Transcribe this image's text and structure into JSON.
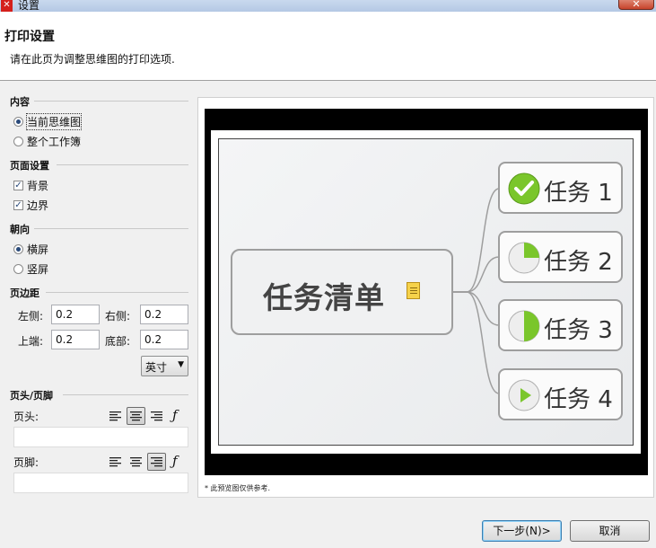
{
  "window": {
    "title": "设置",
    "app_icon_glyph": "✕",
    "close_glyph": "✕"
  },
  "header": {
    "title": "打印设置",
    "subtitle": "请在此页为调整思维图的打印选项."
  },
  "content": {
    "label": "内容",
    "options": [
      {
        "label": "当前思维图",
        "selected": true
      },
      {
        "label": "整个工作簿",
        "selected": false
      }
    ]
  },
  "page_setup": {
    "label": "页面设置",
    "options": [
      {
        "label": "背景",
        "checked": true
      },
      {
        "label": "边界",
        "checked": true
      }
    ]
  },
  "orientation": {
    "label": "朝向",
    "options": [
      {
        "label": "横屏",
        "selected": true
      },
      {
        "label": "竖屏",
        "selected": false
      }
    ]
  },
  "margins": {
    "label": "页边距",
    "left_label": "左侧:",
    "left_value": "0.2",
    "right_label": "右侧:",
    "right_value": "0.2",
    "top_label": "上端:",
    "top_value": "0.2",
    "bottom_label": "底部:",
    "bottom_value": "0.2",
    "unit": "英寸",
    "unit_arrow": "▼"
  },
  "header_footer": {
    "label": "页头/页脚",
    "header_label": "页头:",
    "footer_label": "页脚:",
    "header_selected_align": "center",
    "footer_selected_align": "right",
    "fx_glyph": "ƒ",
    "header_value": "",
    "footer_value": ""
  },
  "preview": {
    "central_topic": "任务清单",
    "tasks": [
      {
        "label": "任务 1",
        "icon": "check-icon",
        "progress": 1.0
      },
      {
        "label": "任务 2",
        "icon": "pie-quarter-icon",
        "progress": 0.25
      },
      {
        "label": "任务 3",
        "icon": "pie-half-icon",
        "progress": 0.5
      },
      {
        "label": "任务 4",
        "icon": "play-icon",
        "progress": 0
      }
    ],
    "note": "* 此预览图仅供参考."
  },
  "buttons": {
    "next": "下一步(N)>",
    "cancel": "取消"
  },
  "colors": {
    "task_green": "#7ac62b",
    "line_gray": "#9e9e9e",
    "titlebar": "#b4c8e4"
  }
}
